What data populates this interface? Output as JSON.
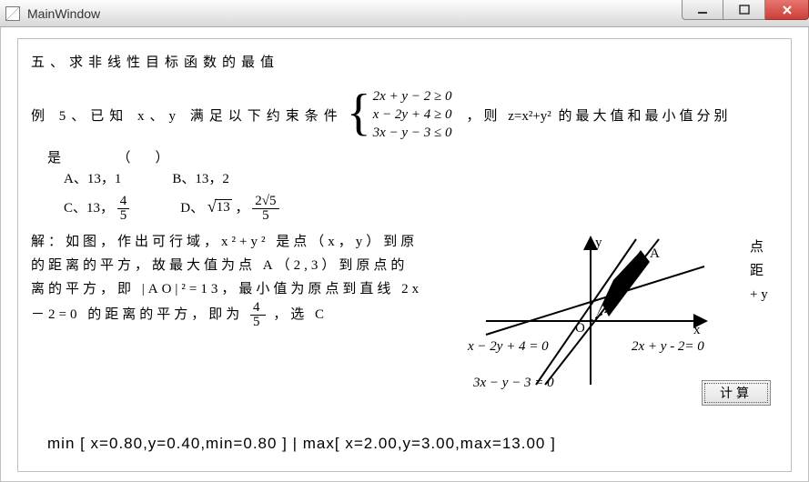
{
  "window": {
    "title": "MainWindow"
  },
  "content": {
    "section_title": "五、求非线性目标函数的最值",
    "problem_lead": "例 5、已知 x、y 满足以下约束条件",
    "constraints": {
      "c1": "2x + y − 2 ≥ 0",
      "c2": "x − 2y + 4 ≥ 0",
      "c3": "3x − y − 3 ≤ 0"
    },
    "problem_tail_prefix": "，则 ",
    "problem_tail_expr": "z=x²+y²",
    "problem_tail_suffix": " 的最大值和最小值分别",
    "is_line": "是　　　（　）",
    "options": {
      "A": "A、13，1",
      "B": "B、13，2",
      "C_prefix": "C、13，",
      "C_frac_num": "4",
      "C_frac_den": "5",
      "D_prefix": "D、",
      "D_sqrt": "13",
      "D_comma": "，",
      "D_frac_num": "2√5",
      "D_frac_den": "5"
    },
    "solution": {
      "l1": "解：如图，作出可行域，x²+y² 是点（x，y）到原",
      "l2": "的距离的平方，故最大值为点 A（2,3）到原点的",
      "l3": "离的平方，即 |AO|²=13，最小值为原点到直线 2x",
      "l4_a": "－2=0 的距离的平方，即为 ",
      "l4_num": "4",
      "l4_den": "5",
      "l4_b": "，选 C"
    },
    "overflow": {
      "o1": "点",
      "o2": "距",
      "o3": "+ y"
    },
    "figure": {
      "y_axis": "y",
      "x_axis": "x",
      "O": "O",
      "A": "A",
      "line1": "x − 2y + 4 = 0",
      "line2": "2x + y - 2= 0",
      "line3": "3x − y − 3 = 0"
    },
    "button_label": "计算",
    "result_line": "min [ x=0.80,y=0.40,min=0.80 ] | max[ x=2.00,y=3.00,max=13.00 ]"
  },
  "chart_data": {
    "type": "diagram",
    "description": "Feasible region plot on xy-plane",
    "lines": [
      {
        "label": "x - 2y + 4 = 0"
      },
      {
        "label": "2x + y - 2 = 0"
      },
      {
        "label": "3x - y - 3 = 0"
      }
    ],
    "points": [
      {
        "name": "O",
        "x": 0,
        "y": 0
      },
      {
        "name": "A",
        "x": 2,
        "y": 3
      }
    ],
    "min": {
      "x": 0.8,
      "y": 0.4,
      "value": 0.8
    },
    "max": {
      "x": 2.0,
      "y": 3.0,
      "value": 13.0
    }
  }
}
